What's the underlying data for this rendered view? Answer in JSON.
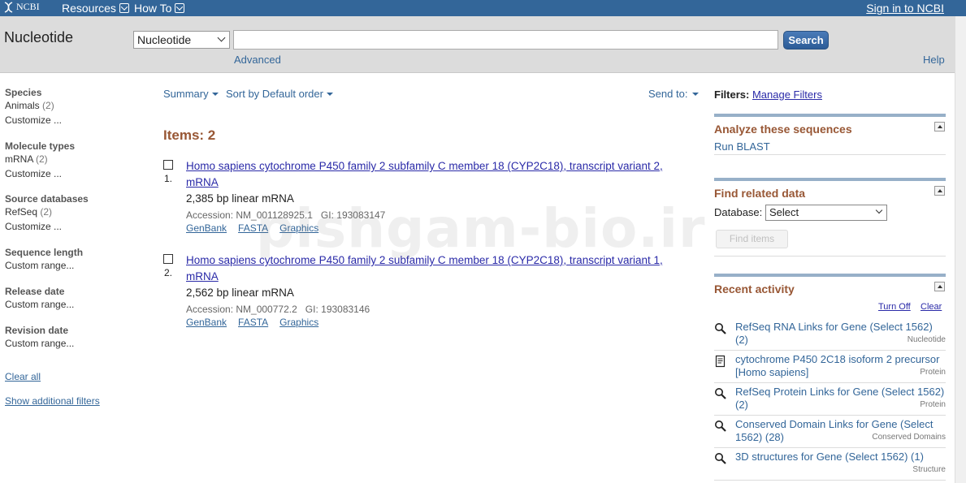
{
  "topbar": {
    "logo": "NCBI",
    "menu": [
      {
        "label": "Resources"
      },
      {
        "label": "How To"
      }
    ],
    "signin": "Sign in to NCBI",
    "bg": "#336699"
  },
  "search": {
    "db_title": "Nucleotide",
    "db_selected": "Nucleotide",
    "term_value": "",
    "button": "Search",
    "advanced": "Advanced",
    "help": "Help"
  },
  "facets": {
    "groups": [
      {
        "title": "Species",
        "items": [
          {
            "label": "Animals",
            "count": "(2)"
          },
          {
            "label": "Customize ...",
            "count": ""
          }
        ]
      },
      {
        "title": "Molecule types",
        "items": [
          {
            "label": "mRNA",
            "count": "(2)"
          },
          {
            "label": "Customize ...",
            "count": ""
          }
        ]
      },
      {
        "title": "Source databases",
        "items": [
          {
            "label": "RefSeq",
            "count": "(2)"
          },
          {
            "label": "Customize ...",
            "count": ""
          }
        ]
      },
      {
        "title": "Sequence length",
        "items": [
          {
            "label": "Custom range...",
            "count": ""
          }
        ]
      },
      {
        "title": "Release date",
        "items": [
          {
            "label": "Custom range...",
            "count": ""
          }
        ]
      },
      {
        "title": "Revision date",
        "items": [
          {
            "label": "Custom range...",
            "count": ""
          }
        ]
      }
    ],
    "clear_all": "Clear all",
    "show_filters": "Show additional filters"
  },
  "results": {
    "summary": "Summary",
    "sort": "Sort by Default order",
    "send_to": "Send to:",
    "items_label": "Items: 2",
    "list": [
      {
        "num": "1.",
        "title": "Homo sapiens cytochrome P450 family 2 subfamily C member 18 (CYP2C18), transcript variant 2, mRNA",
        "desc": "2,385 bp linear mRNA",
        "acc_label": "Accession:",
        "acc": "NM_001128925.1",
        "gi_label": "GI:",
        "gi": "193083147",
        "links": [
          "GenBank",
          "FASTA",
          "Graphics"
        ]
      },
      {
        "num": "2.",
        "title": "Homo sapiens cytochrome P450 family 2 subfamily C member 18 (CYP2C18), transcript variant 1, mRNA",
        "desc": "2,562 bp linear mRNA",
        "acc_label": "Accession:",
        "acc": "NM_000772.2",
        "gi_label": "GI:",
        "gi": "193083146",
        "links": [
          "GenBank",
          "FASTA",
          "Graphics"
        ]
      }
    ]
  },
  "sidebar": {
    "filters_label": "Filters:",
    "manage_filters": "Manage Filters",
    "analyze_title": "Analyze these sequences",
    "run_blast": "Run BLAST",
    "related_title": "Find related data",
    "database_label": "Database:",
    "database_value": "Select",
    "find_items": "Find items",
    "recent_title": "Recent activity",
    "turn_off": "Turn Off",
    "clear": "Clear",
    "activity": [
      {
        "icon": "search-icon",
        "text": "RefSeq RNA Links for Gene (Select 1562) (2)",
        "db": "Nucleotide"
      },
      {
        "icon": "document-icon",
        "text": "cytochrome P450 2C18 isoform 2 precursor [Homo sapiens]",
        "db": "Protein"
      },
      {
        "icon": "search-icon",
        "text": "RefSeq Protein Links for Gene (Select 1562) (2)",
        "db": "Protein"
      },
      {
        "icon": "search-icon",
        "text": "Conserved Domain Links for Gene (Select 1562) (28)",
        "db": "Conserved Domains"
      },
      {
        "icon": "search-icon",
        "text": "3D structures for Gene (Select 1562) (1)",
        "db": "Structure"
      }
    ]
  },
  "watermark": "pishgam-bio.ir",
  "colors": {
    "link": "#336699",
    "result_title": "#2a2aa8",
    "heading": "#985735"
  }
}
